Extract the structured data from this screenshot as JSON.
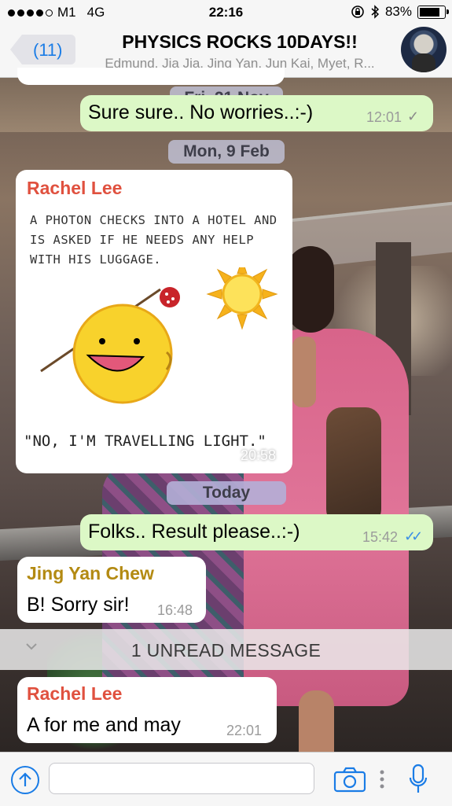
{
  "status_bar": {
    "carrier": "M1",
    "network": "4G",
    "time": "22:16",
    "battery": "83%",
    "battery_fraction": 0.83
  },
  "header": {
    "back_count": "(11)",
    "title": "PHYSICS ROCKS 10DAYS!!",
    "subtitle": "Edmund, Jia Jia, Jing Yan, Jun Kai, Myet, R..."
  },
  "date_pills": {
    "nov": "Fri, 21 Nov",
    "feb": "Mon, 9 Feb",
    "today": "Today"
  },
  "messages": {
    "m1": {
      "text": "Sure sure.. No worries..:-)",
      "time": "12:01",
      "ticks": "✓"
    },
    "m2": {
      "sender": "Rachel Lee",
      "comic_text": "A PHOTON CHECKS INTO A HOTEL AND IS ASKED IF HE NEEDS ANY HELP WITH HIS LUGGAGE.",
      "comic_caption": "\"NO, I'M TRAVELLING LIGHT.\"",
      "time": "20:58"
    },
    "m3": {
      "text": "Folks.. Result please..:-)",
      "time": "15:42",
      "ticks": "✓✓"
    },
    "m4": {
      "sender": "Jing Yan Chew",
      "text": "B! Sorry sir!",
      "time": "16:48"
    },
    "m5": {
      "sender": "Rachel Lee",
      "text": "A for me and may",
      "time": "22:01"
    }
  },
  "unread_divider": "1 UNREAD MESSAGE",
  "input": {
    "value": "",
    "placeholder": ""
  },
  "icons": {
    "back": "chevron-left-icon",
    "upload": "arrow-up-circle-icon",
    "camera": "camera-icon",
    "more": "more-vertical-icon",
    "mic": "microphone-icon"
  },
  "colors": {
    "accent": "#1a7ce6",
    "outgoing_bubble": "#dcf8c6",
    "incoming_bubble": "#ffffff",
    "rachel_name": "#e0513f",
    "jingyan_name": "#b38a12",
    "read_ticks": "#3b8fe6"
  }
}
